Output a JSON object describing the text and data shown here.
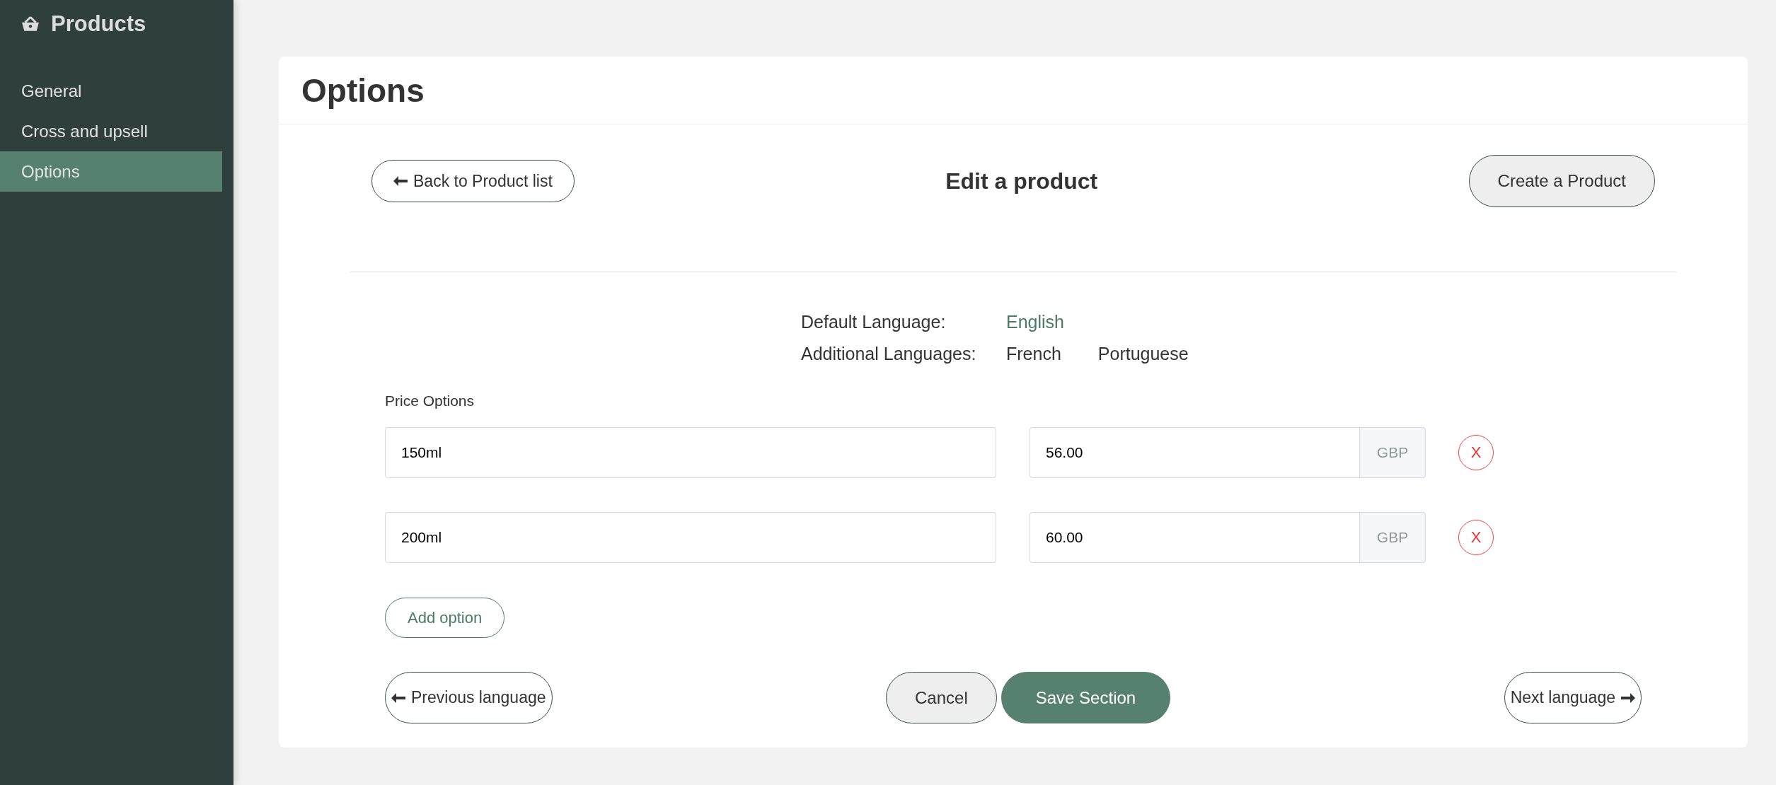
{
  "sidebar": {
    "title": "Products",
    "items": [
      {
        "label": "General",
        "selected": false
      },
      {
        "label": "Cross and upsell",
        "selected": false
      },
      {
        "label": "Options",
        "selected": true
      }
    ]
  },
  "page": {
    "title": "Options"
  },
  "toolbar": {
    "back_button": "Back to Product list",
    "heading": "Edit a product",
    "create_button": "Create a Product"
  },
  "languages": [
    {
      "label": "Default Language:",
      "items": [
        {
          "name": "English",
          "selected": true
        }
      ]
    },
    {
      "label": "Additional Languages:",
      "items": [
        {
          "name": "French",
          "selected": false
        },
        {
          "name": "Portuguese",
          "selected": false
        }
      ]
    }
  ],
  "price_options": {
    "label": "Price Options",
    "rows": [
      {
        "name": "150ml",
        "price": "56.00",
        "currency": "GBP",
        "remove": "X"
      },
      {
        "name": "200ml",
        "price": "60.00",
        "currency": "GBP",
        "remove": "X"
      }
    ],
    "add_button": "Add option"
  },
  "footer": {
    "previous_button": "Previous language",
    "cancel_button": "Cancel",
    "save_button": "Save Section",
    "next_button": "Next language"
  }
}
